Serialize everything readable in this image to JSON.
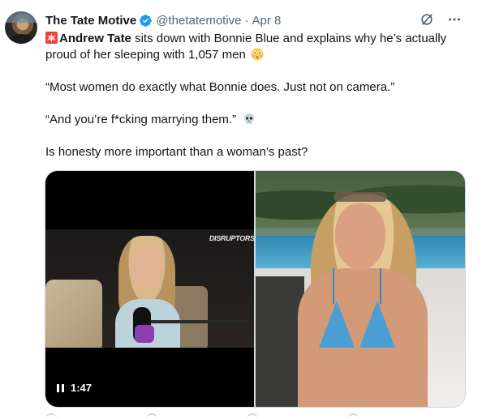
{
  "author": {
    "name": "The Tate Motive",
    "handle": "@thetatemotive",
    "separator": "·",
    "date": "Apr 8"
  },
  "tweet": {
    "line1_name": "Andrew Tate",
    "line1_rest": " sits down with Bonnie Blue and explains why he’s actually proud of her sleeping with 1,057 men",
    "quote1": "“Most women do exactly what Bonnie does. Just not on camera.”",
    "quote2": "“And you’re f*cking marrying them.”",
    "question": "Is honesty more important than a woman’s past?"
  },
  "media": {
    "video_duration": "1:47",
    "video_watermark": "DISRUPTORS"
  },
  "icons": {
    "verified": "verified-badge-icon",
    "grok": "grok-icon",
    "more": "more-icon",
    "siren": "siren-emoji",
    "flushed": "flushed-face-emoji",
    "skull": "skull-emoji",
    "pause": "pause-icon"
  },
  "colors": {
    "verified_blue": "#1d9bf0",
    "text": "#0f1419",
    "muted": "#536471",
    "border": "#cfd9de"
  }
}
